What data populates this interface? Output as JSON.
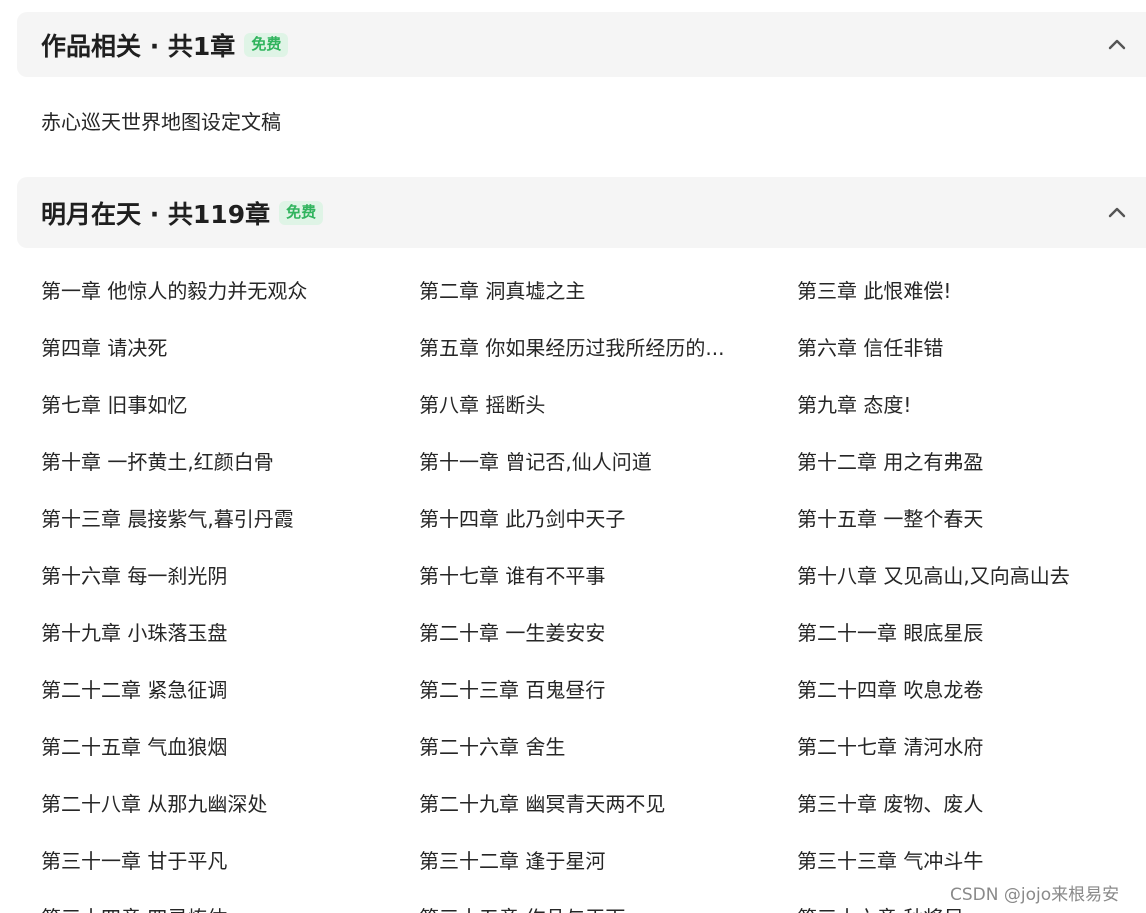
{
  "volumes": [
    {
      "title": "作品相关 · 共1章",
      "badge": "免费",
      "chapters": [
        "赤心巡天世界地图设定文稿"
      ]
    },
    {
      "title": "明月在天 · 共119章",
      "badge": "免费",
      "chapters": [
        "第一章 他惊人的毅力并无观众",
        "第二章 洞真墟之主",
        "第三章 此恨难偿!",
        "第四章 请决死",
        "第五章 你如果经历过我所经历的...",
        "第六章 信任非错",
        "第七章 旧事如忆",
        "第八章 摇断头",
        "第九章 态度!",
        "第十章 一抔黄土,红颜白骨",
        "第十一章 曾记否,仙人问道",
        "第十二章 用之有弗盈",
        "第十三章 晨接紫气,暮引丹霞",
        "第十四章 此乃剑中天子",
        "第十五章 一整个春天",
        "第十六章 每一刹光阴",
        "第十七章 谁有不平事",
        "第十八章 又见高山,又向高山去",
        "第十九章 小珠落玉盘",
        "第二十章 一生姜安安",
        "第二十一章 眼底星辰",
        "第二十二章 紧急征调",
        "第二十三章 百鬼昼行",
        "第二十四章 吹息龙卷",
        "第二十五章 气血狼烟",
        "第二十六章 舍生",
        "第二十七章 清河水府",
        "第二十八章 从那九幽深处",
        "第二十九章 幽冥青天两不见",
        "第三十章 废物、废人",
        "第三十一章 甘于平凡",
        "第三十二章 逢于星河",
        "第三十三章 气冲斗牛",
        "第三十四章 四灵炼体",
        "第三十五章 作品与天下",
        "第三十六章 秋将尽"
      ]
    }
  ],
  "watermark": "CSDN @jojo来根易安",
  "icons": {
    "collapse": "chevron-up-icon"
  },
  "colors": {
    "badge_text": "#31b45e",
    "badge_bg": "#dff4e6",
    "header_bg": "#f5f5f5"
  }
}
